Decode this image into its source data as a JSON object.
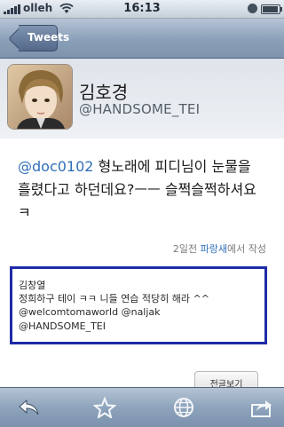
{
  "status_bar": {
    "carrier": "olleh",
    "time": "16:13",
    "battery_level": 0.85
  },
  "nav": {
    "back_label": "Tweets"
  },
  "profile": {
    "name": "김호경",
    "handle": "@HANDSOME_TEI"
  },
  "tweet": {
    "mention": "@doc0102",
    "text": " 형노래에 피디님이 눈물을 흘렸다고 하던데요?ㅡㅡ 슬쩍슬쩍하셔요 ㅋ"
  },
  "meta": {
    "time_ago": "2일전",
    "app": "파랑새",
    "suffix": "에서 작성"
  },
  "quoted": {
    "author": "김창열",
    "line1": "정희하구 테이 ㅋㅋ 니들 연습 적당히 해라 ^^",
    "line2": "@welcomtomaworld  @naljak",
    "line3": "@HANDSOME_TEI"
  },
  "full_view_label": "전글보기",
  "toolbar": {
    "icons": [
      "reply-icon",
      "star-icon",
      "globe-icon",
      "share-icon"
    ]
  },
  "colors": {
    "link": "#2f6fb8",
    "highlight_border": "#1f2ba7",
    "nav_bar": "#8aa0b8"
  }
}
